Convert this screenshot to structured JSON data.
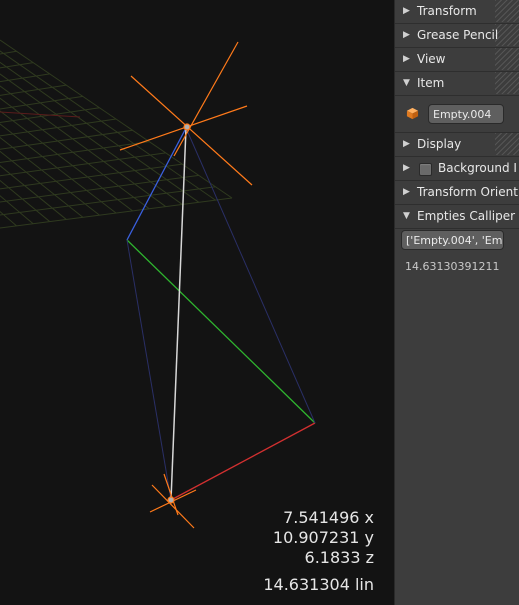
{
  "readout": {
    "x": "7.541496 x",
    "y": "10.907231 y",
    "z": "6.1833 z",
    "lin": "14.631304 lin"
  },
  "panel": {
    "transform": "Transform",
    "grease_pencil": "Grease Pencil",
    "view": "View",
    "item": "Item",
    "item_name": "Empty.004",
    "display": "Display",
    "background": "Background I",
    "transform_orient": "Transform Orient",
    "empties_calliper": "Empties Calliper",
    "calliper_field": "['Empty.004', 'Empt",
    "calliper_value": "14.63130391211"
  },
  "icons": {
    "collapsed": "triangle-right-icon",
    "expanded": "triangle-down-icon",
    "object": "orange-cube-icon"
  },
  "colors": {
    "x_axis": "#e03030",
    "y_axis": "#30c030",
    "z_axis": "#3060e0",
    "empty": "#ff7a1a",
    "measure_line": "#d8d8d8"
  }
}
